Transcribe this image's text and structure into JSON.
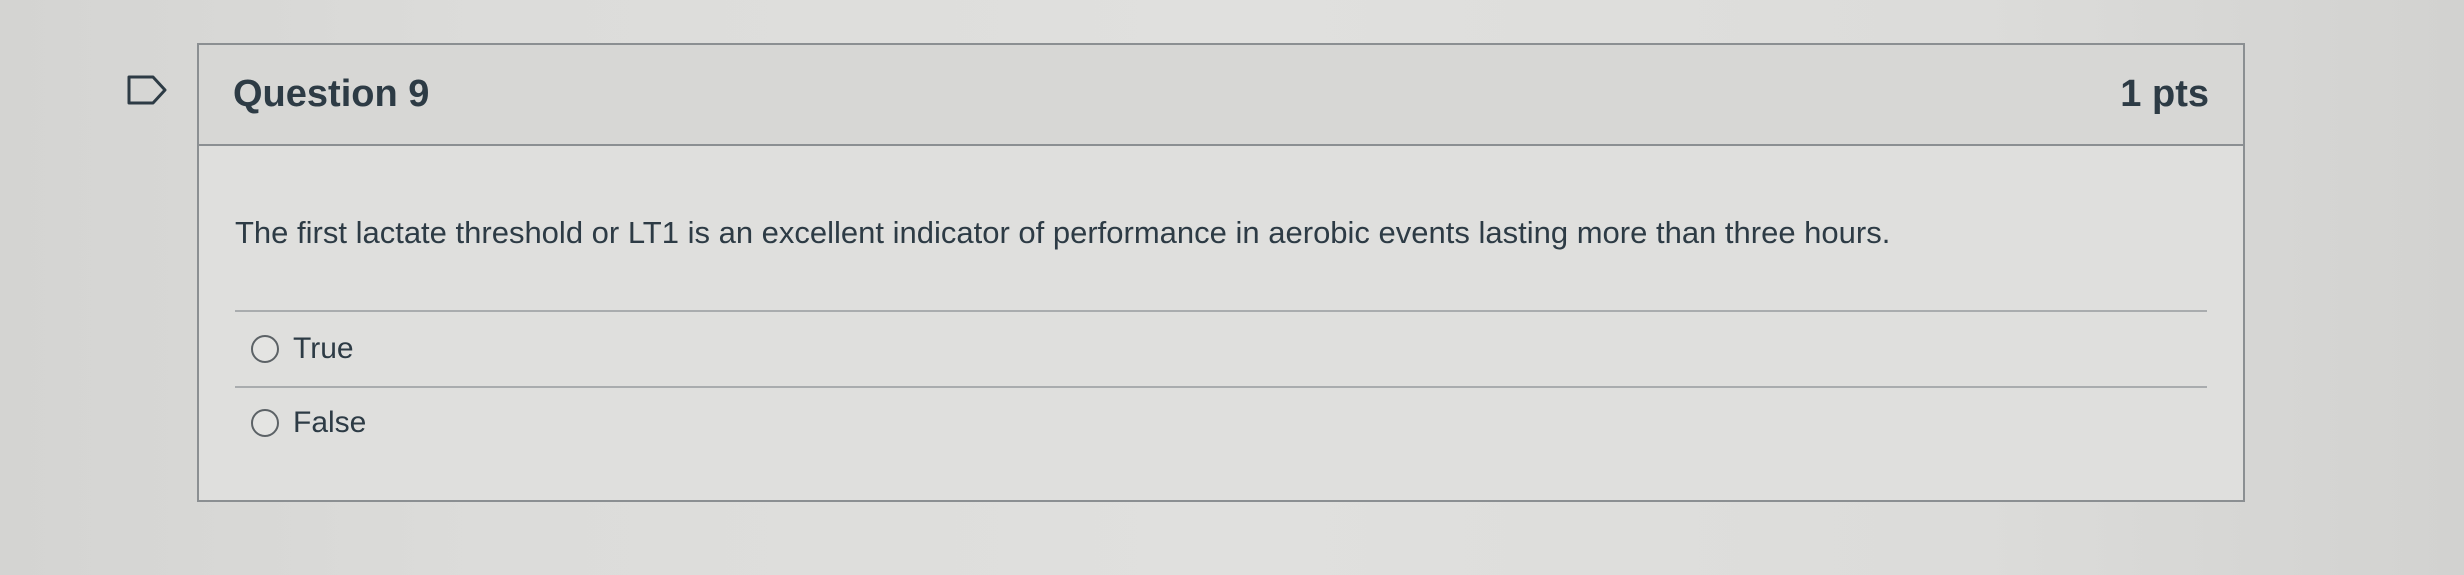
{
  "question": {
    "title": "Question 9",
    "points": "1 pts",
    "text": "The first lactate threshold or LT1 is an excellent indicator of performance in aerobic events lasting more than three hours.",
    "flag_icon": "flag-icon",
    "answers": [
      {
        "label": "True",
        "selected": false
      },
      {
        "label": "False",
        "selected": false
      }
    ]
  },
  "colors": {
    "text": "#2d3b45",
    "border": "#8b8f92",
    "background": "#dfdfdd"
  }
}
